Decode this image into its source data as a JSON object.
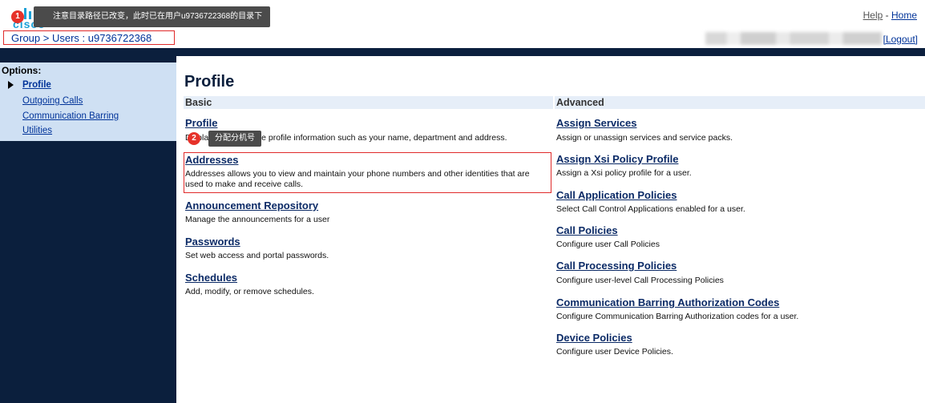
{
  "header": {
    "logo_text": "cisco",
    "tip1_badge": "1",
    "tip1_text": "注意目录路径已改变，此时已在用户u9736722368的目录下",
    "help_label": "Help",
    "home_label": "Home",
    "link_separator": "-",
    "breadcrumb": "Group > Users : u9736722368",
    "logout_label": "[Logout]"
  },
  "sidebar": {
    "title": "Options:",
    "items": [
      {
        "label": "Profile",
        "active": true
      },
      {
        "label": "Outgoing Calls"
      },
      {
        "label": "Communication Barring"
      },
      {
        "label": "Utilities"
      }
    ]
  },
  "main": {
    "title": "Profile",
    "basic_header": "Basic",
    "advanced_header": "Advanced",
    "tip2_badge": "2",
    "tip2_text": "分配分机号",
    "basic": [
      {
        "title": "Profile",
        "desc": "Display and configure profile information such as your name, department and address."
      },
      {
        "title": "Addresses",
        "desc": "Addresses allows you to view and maintain your phone numbers and other identities that are used to make and receive calls."
      },
      {
        "title": "Announcement Repository",
        "desc": "Manage the announcements for a user"
      },
      {
        "title": "Passwords",
        "desc": "Set web access and portal passwords."
      },
      {
        "title": "Schedules",
        "desc": "Add, modify, or remove schedules."
      }
    ],
    "advanced": [
      {
        "title": "Assign Services",
        "desc": "Assign or unassign services and service packs."
      },
      {
        "title": "Assign Xsi Policy Profile",
        "desc": "Assign a Xsi policy profile for a user."
      },
      {
        "title": "Call Application Policies",
        "desc": "Select Call Control Applications enabled for a user."
      },
      {
        "title": "Call Policies",
        "desc": "Configure user Call Policies"
      },
      {
        "title": "Call Processing Policies",
        "desc": "Configure user-level Call Processing Policies"
      },
      {
        "title": "Communication Barring Authorization Codes",
        "desc": "Configure Communication Barring Authorization codes for a user."
      },
      {
        "title": "Device Policies",
        "desc": "Configure user Device Policies."
      }
    ]
  }
}
